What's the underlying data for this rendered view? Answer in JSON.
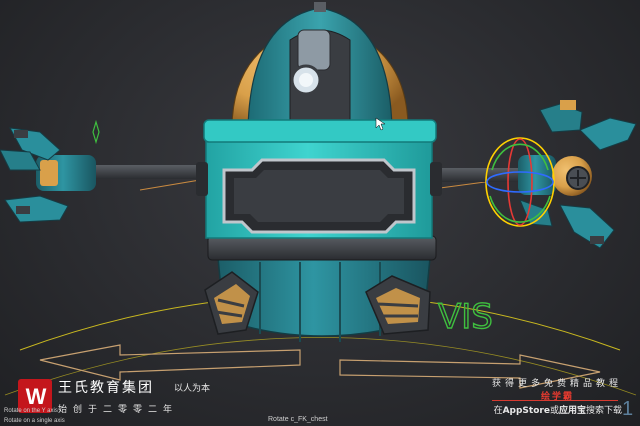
{
  "viewport": {
    "background": "#2b2c30",
    "gizmo_colors": {
      "x_axis": "#e53935",
      "y_axis": "#3fbf3f",
      "z_axis": "#2f6bff",
      "view_ring": "#ffd100",
      "selection": "#e6a24a"
    },
    "robot_colors": {
      "teal": "#2a8f9c",
      "cyan_band": "#2fc2c0",
      "orange": "#d9a04a",
      "dark_steel": "#3a3d42"
    },
    "floor_marker": "VIS"
  },
  "status": {
    "hint_y_axis": "Rotate on the Y axis",
    "hint_single_axis": "Rotate on a single axis",
    "hint_control": "Rotate c_FK_chest"
  },
  "brand": {
    "logo": "W",
    "name": "王氏教育集团",
    "slogan": "以人为本",
    "founded": "始创于二零零二年"
  },
  "promo": {
    "line1": "获得更多免费精品教程",
    "line2": "绘学霸",
    "line3_prefix": "在",
    "line3_store1": "AppStore",
    "line3_or": "或",
    "line3_store2": "应用宝",
    "line3_suffix": "搜索下载"
  },
  "page_number": "1"
}
